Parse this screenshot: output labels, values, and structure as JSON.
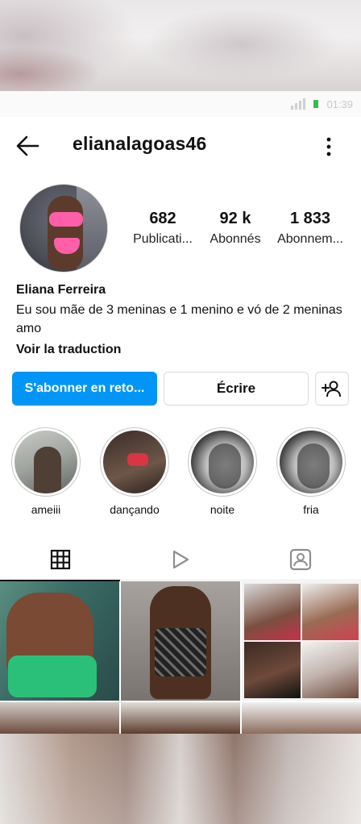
{
  "status_bar": {
    "time": "01:39"
  },
  "header": {
    "username": "elianalagoas46"
  },
  "profile": {
    "stats": [
      {
        "value": "682",
        "label": "Publicati..."
      },
      {
        "value": "92 k",
        "label": "Abonnés"
      },
      {
        "value": "1 833",
        "label": "Abonnem..."
      }
    ],
    "full_name": "Eliana Ferreira",
    "bio": "Eu sou mãe de 3 meninas e 1 menino e vó de 2 meninas amo",
    "translate_label": "Voir la traduction"
  },
  "actions": {
    "follow_label": "S'abonner en reto...",
    "message_label": "Écrire"
  },
  "highlights": [
    {
      "label": "ameiii"
    },
    {
      "label": "dançando"
    },
    {
      "label": "noite"
    },
    {
      "label": "fria"
    }
  ],
  "tabs": [
    {
      "icon": "grid-icon",
      "active": true
    },
    {
      "icon": "reels-icon",
      "active": false
    },
    {
      "icon": "tagged-icon",
      "active": false
    }
  ],
  "colors": {
    "accent": "#0095f6",
    "text": "#111111"
  }
}
